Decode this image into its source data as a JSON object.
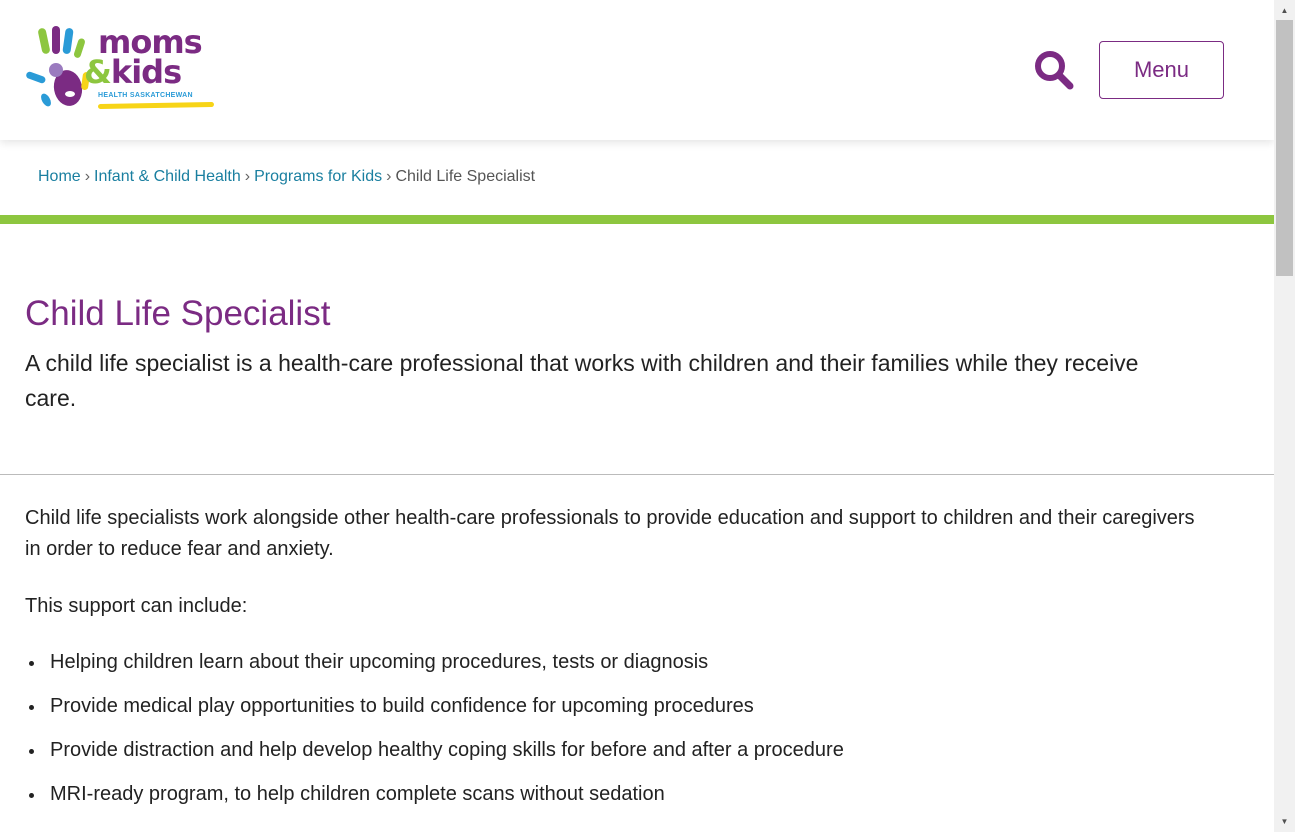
{
  "header": {
    "logo": {
      "line1": "moms",
      "amp": "&",
      "line2": "kids",
      "subtitle": "HEALTH SASKATCHEWAN"
    },
    "search_icon": "search-icon",
    "menu_label": "Menu"
  },
  "breadcrumb": {
    "items": [
      "Home",
      "Infant & Child Health",
      "Programs for Kids"
    ],
    "separator": "›",
    "current": "Child Life Specialist"
  },
  "page": {
    "title": "Child Life Specialist",
    "lead": "A child life specialist is a health-care professional that works with children and their families while they receive care.",
    "paragraph1": "Child life specialists work alongside other health-care professionals to provide education and support to children and their caregivers in order to reduce fear and anxiety.",
    "paragraph2": "This support can include:",
    "support_items": [
      "Helping children learn about their upcoming procedures, tests or diagnosis",
      "Provide medical play opportunities to build confidence for upcoming procedures",
      "Provide distraction and help develop healthy coping skills for before and after a procedure",
      "MRI-ready program, to help children complete scans without sedation"
    ]
  },
  "colors": {
    "brand_purple": "#7b2b83",
    "brand_green": "#8dc63f",
    "link_teal": "#1a7fa0",
    "logo_blue": "#2a9bd7",
    "logo_yellow": "#f7d417"
  }
}
